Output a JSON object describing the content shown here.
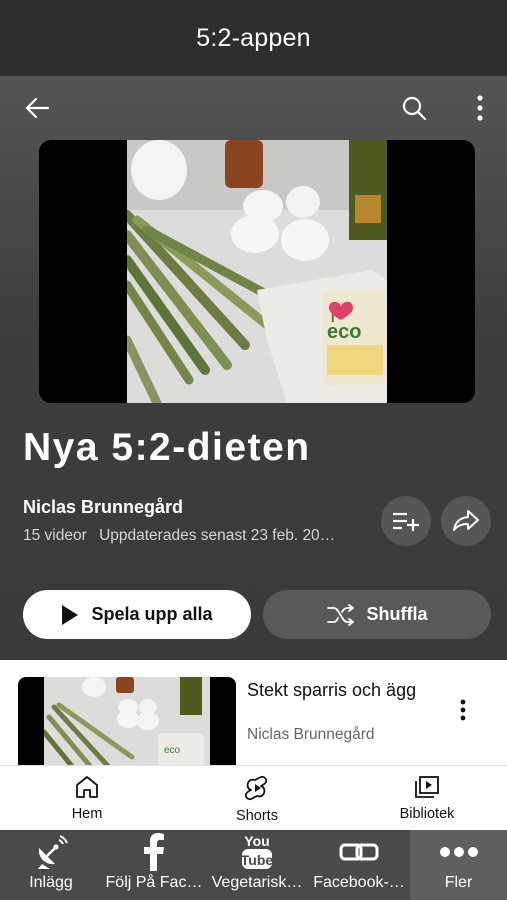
{
  "app": {
    "title": "5:2-appen"
  },
  "toolbar": {
    "back_icon": "arrow-left-icon",
    "search_icon": "search-icon",
    "more_icon": "more-vertical-icon"
  },
  "playlist": {
    "title": "Nya 5:2-dieten",
    "owner": "Niclas Brunnegård",
    "video_count": "15 videor",
    "updated": "Uppdaterades senast 23 feb. 20…",
    "play_all_label": "Spela upp alla",
    "shuffle_label": "Shuffla"
  },
  "items": [
    {
      "title": "Stekt sparris och ägg",
      "author": "Niclas Brunnegård"
    }
  ],
  "yt_nav": [
    {
      "label": "Hem",
      "icon": "home-icon"
    },
    {
      "label": "Shorts",
      "icon": "shorts-icon"
    },
    {
      "label": "Bibliotek",
      "icon": "library-icon"
    }
  ],
  "app_nav": [
    {
      "label": "Inlägg",
      "icon": "satellite-icon"
    },
    {
      "label": "Följ På Fac…",
      "icon": "facebook-icon"
    },
    {
      "label": "Vegetarisk…",
      "icon": "youtube-icon"
    },
    {
      "label": "Facebook-…",
      "icon": "link-icon"
    },
    {
      "label": "Fler",
      "icon": "more-horizontal-icon"
    }
  ],
  "colors": {
    "appbar": "#2e2e2e",
    "hero": "#3d3d3d",
    "app_nav": "#4a4a4a",
    "active_tab": "#5f5f5f"
  }
}
